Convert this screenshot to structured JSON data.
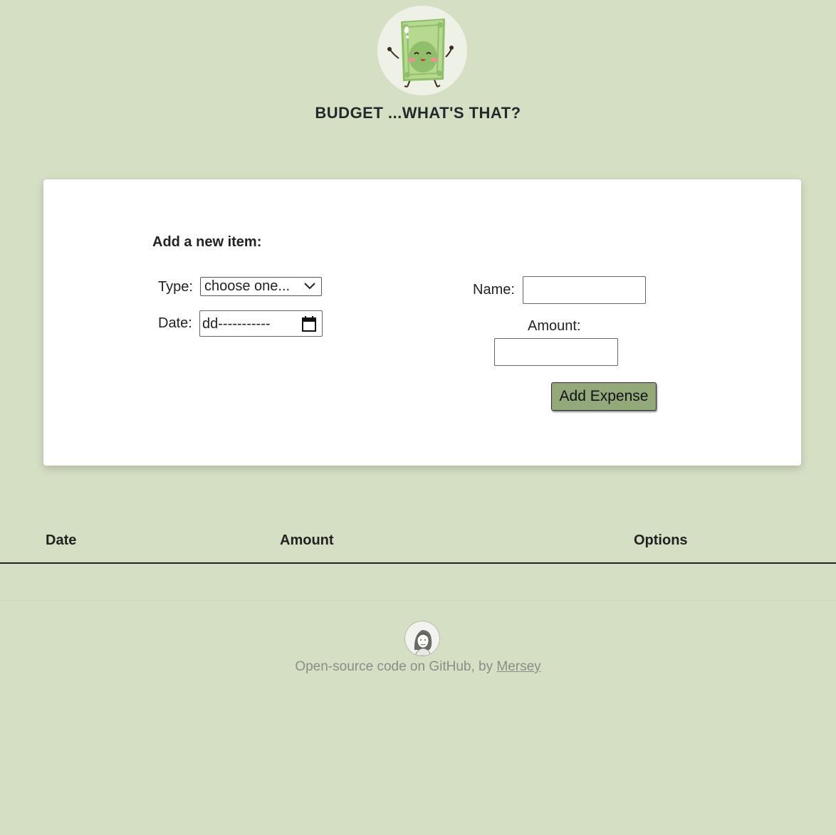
{
  "header": {
    "title": "BUDGET ...WHAT'S THAT?"
  },
  "form": {
    "heading": "Add a new item:",
    "type_label": "Type:",
    "type_selected": "choose one...",
    "date_label": "Date:",
    "date_value": "dd-----------",
    "name_label": "Name:",
    "name_value": "",
    "amount_label": "Amount:",
    "amount_value": "",
    "submit_label": "Add Expense"
  },
  "table": {
    "columns": [
      "Date",
      "Amount",
      "Options"
    ],
    "rows": []
  },
  "footer": {
    "text_prefix": "Open-source code on GitHub, by",
    "author_link": "Mersey"
  },
  "colors": {
    "background": "#d5dfc4",
    "card": "#ffffff",
    "button": "#93a97a",
    "footer_text": "#8b8d86"
  },
  "icons": {
    "logo": "money-mascot-icon",
    "select_arrow": "chevron-down-icon",
    "date_picker": "calendar-icon",
    "author": "author-avatar"
  }
}
